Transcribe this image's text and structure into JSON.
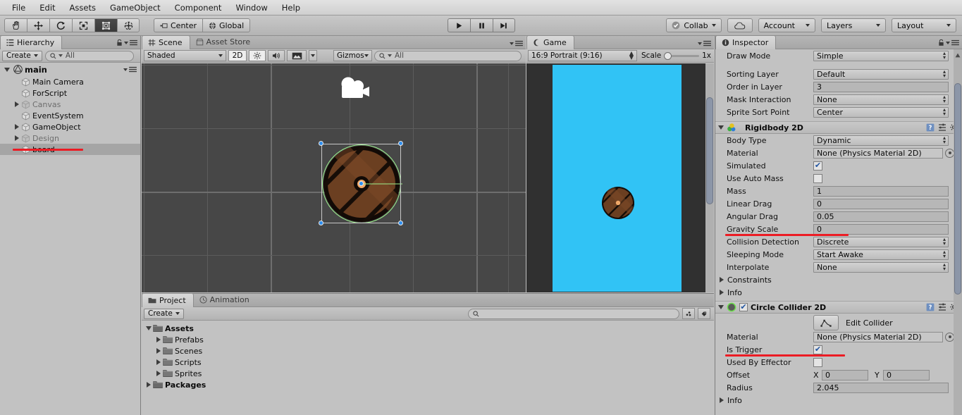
{
  "menubar": {
    "items": [
      "File",
      "Edit",
      "Assets",
      "GameObject",
      "Component",
      "Window",
      "Help"
    ]
  },
  "toolbar": {
    "tools": [
      "hand-tool",
      "move-tool",
      "rotate-tool",
      "scale-tool",
      "rect-tool",
      "transform-tool"
    ],
    "active_tool": "rect-tool",
    "pivot_label": "Center",
    "space_label": "Global",
    "play_label": "play",
    "pause_label": "pause",
    "step_label": "step",
    "collab_label": "Collab",
    "cloud_label": "cloud",
    "account_label": "Account",
    "layers_label": "Layers",
    "layout_label": "Layout"
  },
  "hierarchy": {
    "tab_label": "Hierarchy",
    "create_label": "Create",
    "search_placeholder": "All",
    "root": "main",
    "items": [
      {
        "label": "Main Camera",
        "indent": 1,
        "expandable": false,
        "dim": false,
        "selected": false
      },
      {
        "label": "ForScript",
        "indent": 1,
        "expandable": false,
        "dim": false,
        "selected": false
      },
      {
        "label": "Canvas",
        "indent": 1,
        "expandable": true,
        "dim": true,
        "selected": false
      },
      {
        "label": "EventSystem",
        "indent": 1,
        "expandable": false,
        "dim": false,
        "selected": false
      },
      {
        "label": "GameObject",
        "indent": 1,
        "expandable": true,
        "dim": false,
        "selected": false
      },
      {
        "label": "Design",
        "indent": 1,
        "expandable": true,
        "dim": true,
        "selected": false
      },
      {
        "label": "board",
        "indent": 1,
        "expandable": false,
        "dim": false,
        "selected": true
      }
    ]
  },
  "scene": {
    "tabs": [
      {
        "label": "Scene",
        "active": true
      },
      {
        "label": "Asset Store",
        "active": false
      }
    ],
    "shading_label": "Shaded",
    "mode_2d_label": "2D",
    "lighting_icon": "sun-icon",
    "audio_icon": "speaker-icon",
    "effects_icon": "image-icon",
    "gizmos_label": "Gizmos",
    "search_placeholder": "All",
    "background_color": "#474747",
    "grid_color": "#5c5c5c",
    "selection_outline_color": "#c8c8c8",
    "handle_color": "#2d8ef0",
    "collider_gizmo_color": "#9cf08c",
    "camera_gizmo": "camera-icon"
  },
  "game": {
    "tab_label": "Game",
    "aspect_label": "16:9 Portrait (9:16)",
    "scale_label": "Scale",
    "scale_value": "1x",
    "background_color": "#31c3f5",
    "letterbox_color": "#303030"
  },
  "project": {
    "tabs": [
      {
        "label": "Project",
        "active": true
      },
      {
        "label": "Animation",
        "active": false
      }
    ],
    "create_label": "Create",
    "search_placeholder": "",
    "tree": [
      {
        "label": "Assets",
        "indent": 0,
        "expanded": true,
        "bold": true
      },
      {
        "label": "Prefabs",
        "indent": 1,
        "expanded": false,
        "bold": false
      },
      {
        "label": "Scenes",
        "indent": 1,
        "expanded": false,
        "bold": false
      },
      {
        "label": "Scripts",
        "indent": 1,
        "expanded": false,
        "bold": false
      },
      {
        "label": "Sprites",
        "indent": 1,
        "expanded": false,
        "bold": false
      },
      {
        "label": "Packages",
        "indent": 0,
        "expanded": false,
        "bold": true
      }
    ]
  },
  "inspector": {
    "tab_label": "Inspector",
    "sprite_renderer_props": [
      {
        "label": "Draw Mode",
        "type": "dropdown",
        "value": "Simple"
      },
      {
        "label": "Sorting Layer",
        "type": "dropdown",
        "value": "Default"
      },
      {
        "label": "Order in Layer",
        "type": "text",
        "value": "3"
      },
      {
        "label": "Mask Interaction",
        "type": "dropdown",
        "value": "None"
      },
      {
        "label": "Sprite Sort Point",
        "type": "dropdown",
        "value": "Center"
      }
    ],
    "rigidbody": {
      "title": "Rigidbody 2D",
      "props": [
        {
          "label": "Body Type",
          "type": "dropdown",
          "value": "Dynamic"
        },
        {
          "label": "Material",
          "type": "object",
          "value": "None (Physics Material 2D)"
        },
        {
          "label": "Simulated",
          "type": "checkbox",
          "value": true
        },
        {
          "label": "Use Auto Mass",
          "type": "checkbox",
          "value": false
        },
        {
          "label": "Mass",
          "type": "text",
          "value": "1"
        },
        {
          "label": "Linear Drag",
          "type": "text",
          "value": "0"
        },
        {
          "label": "Angular Drag",
          "type": "text",
          "value": "0.05"
        },
        {
          "label": "Gravity Scale",
          "type": "text",
          "value": "0",
          "annotated": true
        },
        {
          "label": "Collision Detection",
          "type": "dropdown",
          "value": "Discrete"
        },
        {
          "label": "Sleeping Mode",
          "type": "dropdown",
          "value": "Start Awake"
        },
        {
          "label": "Interpolate",
          "type": "dropdown",
          "value": "None"
        }
      ],
      "foldouts": [
        "Constraints",
        "Info"
      ]
    },
    "circle_collider": {
      "title": "Circle Collider 2D",
      "enabled": true,
      "edit_collider_label": "Edit Collider",
      "props": [
        {
          "label": "Material",
          "type": "object",
          "value": "None (Physics Material 2D)"
        },
        {
          "label": "Is Trigger",
          "type": "checkbox",
          "value": true,
          "annotated": true
        },
        {
          "label": "Used By Effector",
          "type": "checkbox",
          "value": false
        },
        {
          "label": "Offset",
          "type": "xy",
          "x_label": "X",
          "x_value": "0",
          "y_label": "Y",
          "y_value": "0"
        },
        {
          "label": "Radius",
          "type": "text",
          "value": "2.045"
        }
      ],
      "foldouts": [
        "Info"
      ]
    },
    "annotation_color": "#ec1c24"
  }
}
